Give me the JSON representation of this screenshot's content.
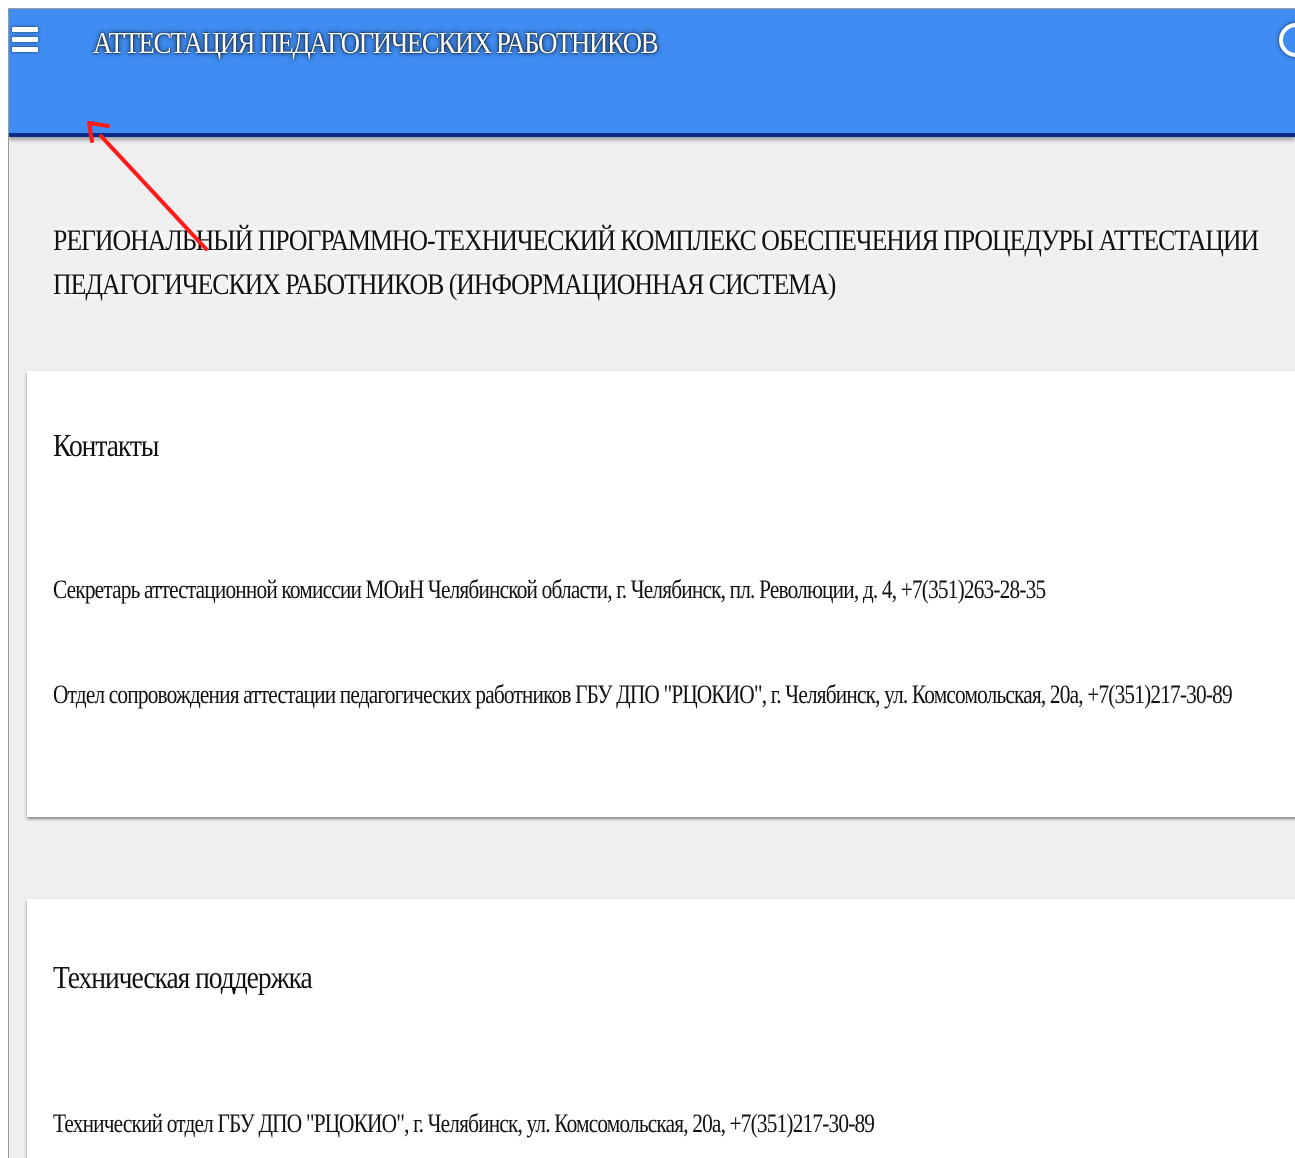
{
  "header": {
    "menu_icon": "hamburger-menu-icon",
    "title": "АТТЕСТАЦИЯ ПЕДАГОГИЧЕСКИХ РАБОТНИКОВ",
    "right_icon": "circle-icon",
    "bar_color": "#3f8cf2",
    "border_color": "#0a2a8a"
  },
  "main": {
    "heading_line1": "РЕГИОНАЛЬНЫЙ ПРОГРАММНО-ТЕХНИЧЕСКИЙ КОМПЛЕКС ОБЕСПЕЧЕНИЯ ПРОЦЕДУРЫ АТТЕСТАЦИИ",
    "heading_line2": "ПЕДАГОГИЧЕСКИХ РАБОТНИКОВ (ИНФОРМАЦИОННАЯ СИСТЕМА)"
  },
  "contacts": {
    "title": "Контакты",
    "lines": [
      "Секретарь аттестационной комиссии МОиН Челябинской области, г. Челябинск, пл. Революции, д. 4, +7(351)263-28-35",
      "Отдел сопровождения аттестации педагогических работников ГБУ ДПО \"РЦОКИО\", г. Челябинск, ул. Комсомольская, 20а, +7(351)217-30-89"
    ]
  },
  "support": {
    "title": "Техническая поддержка",
    "lines": [
      "Технический отдел ГБУ ДПО \"РЦОКИО\", г. Челябинск, ул. Комсомольская, 20а, +7(351)217-30-89"
    ]
  },
  "annotation": {
    "arrow_icon": "red-arrow-icon",
    "arrow_color": "#ff1a1a"
  }
}
